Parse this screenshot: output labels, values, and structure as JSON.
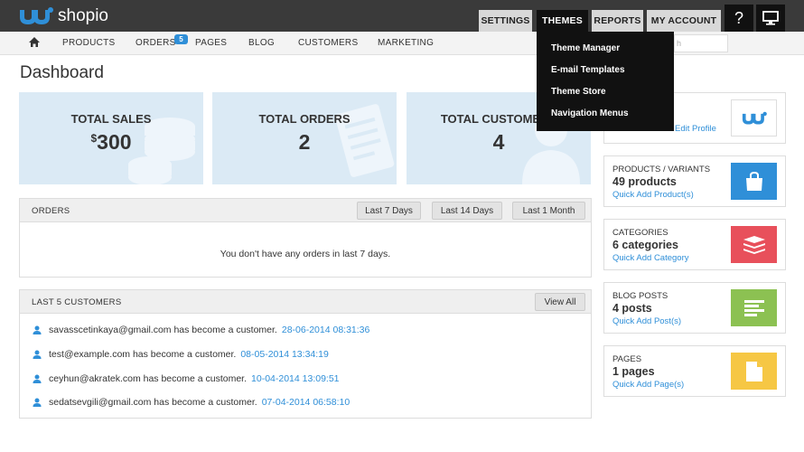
{
  "app": {
    "logo_text": "shopio"
  },
  "topnav": {
    "settings": "SETTINGS",
    "themes": "THEMES",
    "reports": "REPORTS",
    "account": "MY ACCOUNT",
    "help_glyph": "?"
  },
  "subnav": {
    "products": "PRODUCTS",
    "orders": "ORDERS",
    "orders_badge": "5",
    "pages": "PAGES",
    "blog": "BLOG",
    "customers": "CUSTOMERS",
    "marketing": "MARKETING",
    "search_fragment": "h"
  },
  "themes_menu": [
    "Theme Manager",
    "E-mail Templates",
    "Theme Store",
    "Navigation Menus"
  ],
  "page_title": "Dashboard",
  "stats": {
    "sales": {
      "label": "TOTAL SALES",
      "currency": "$",
      "value": "300"
    },
    "orders": {
      "label": "TOTAL ORDERS",
      "value": "2"
    },
    "customers": {
      "label": "TOTAL CUSTOMERS",
      "value": "4"
    }
  },
  "orders_panel": {
    "title": "ORDERS",
    "btn_7": "Last 7 Days",
    "btn_14": "Last 14 Days",
    "btn_month": "Last 1 Month",
    "empty": "You don't have any orders in last 7 days."
  },
  "customers_panel": {
    "title": "LAST 5 CUSTOMERS",
    "view_all": "View All",
    "rows": [
      {
        "text": "savasscetinkaya@gmail.com has become a customer.",
        "date": "28-06-2014 08:31:36"
      },
      {
        "text": "test@example.com has become a customer.",
        "date": "08-05-2014 13:34:19"
      },
      {
        "text": "ceyhun@akratek.com has become a customer.",
        "date": "10-04-2014 13:09:51"
      },
      {
        "text": "sedatsevgili@gmail.com has become a customer.",
        "date": "07-04-2014 06:58:10"
      }
    ]
  },
  "cards": {
    "profile": {
      "link": "Edit Profile"
    },
    "products": {
      "label": "PRODUCTS / VARIANTS",
      "value": "49 products",
      "link": "Quick Add Product(s)",
      "color": "#2f8fd8"
    },
    "categories": {
      "label": "CATEGORIES",
      "value": "6 categories",
      "link": "Quick Add Category",
      "color": "#e8505b"
    },
    "blog": {
      "label": "BLOG POSTS",
      "value": "4 posts",
      "link": "Quick Add Post(s)",
      "color": "#8cc152"
    },
    "pages": {
      "label": "PAGES",
      "value": "1 pages",
      "link": "Quick Add Page(s)",
      "color": "#f6c744"
    }
  },
  "colors": {
    "accent": "#2f8fd8",
    "topbar": "#3a3a3a",
    "stat_bg": "#dbeaf5"
  }
}
